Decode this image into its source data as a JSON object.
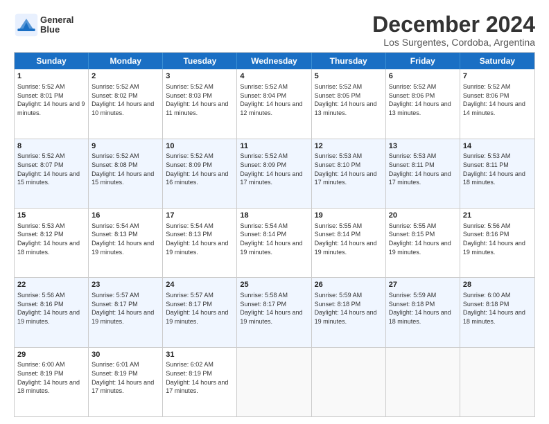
{
  "logo": {
    "line1": "General",
    "line2": "Blue"
  },
  "title": "December 2024",
  "location": "Los Surgentes, Cordoba, Argentina",
  "days_of_week": [
    "Sunday",
    "Monday",
    "Tuesday",
    "Wednesday",
    "Thursday",
    "Friday",
    "Saturday"
  ],
  "weeks": [
    [
      {
        "day": "1",
        "sunrise": "5:52 AM",
        "sunset": "8:01 PM",
        "daylight": "14 hours and 9 minutes."
      },
      {
        "day": "2",
        "sunrise": "5:52 AM",
        "sunset": "8:02 PM",
        "daylight": "14 hours and 10 minutes."
      },
      {
        "day": "3",
        "sunrise": "5:52 AM",
        "sunset": "8:03 PM",
        "daylight": "14 hours and 11 minutes."
      },
      {
        "day": "4",
        "sunrise": "5:52 AM",
        "sunset": "8:04 PM",
        "daylight": "14 hours and 12 minutes."
      },
      {
        "day": "5",
        "sunrise": "5:52 AM",
        "sunset": "8:05 PM",
        "daylight": "14 hours and 13 minutes."
      },
      {
        "day": "6",
        "sunrise": "5:52 AM",
        "sunset": "8:06 PM",
        "daylight": "14 hours and 13 minutes."
      },
      {
        "day": "7",
        "sunrise": "5:52 AM",
        "sunset": "8:06 PM",
        "daylight": "14 hours and 14 minutes."
      }
    ],
    [
      {
        "day": "8",
        "sunrise": "5:52 AM",
        "sunset": "8:07 PM",
        "daylight": "14 hours and 15 minutes."
      },
      {
        "day": "9",
        "sunrise": "5:52 AM",
        "sunset": "8:08 PM",
        "daylight": "14 hours and 15 minutes."
      },
      {
        "day": "10",
        "sunrise": "5:52 AM",
        "sunset": "8:09 PM",
        "daylight": "14 hours and 16 minutes."
      },
      {
        "day": "11",
        "sunrise": "5:52 AM",
        "sunset": "8:09 PM",
        "daylight": "14 hours and 17 minutes."
      },
      {
        "day": "12",
        "sunrise": "5:53 AM",
        "sunset": "8:10 PM",
        "daylight": "14 hours and 17 minutes."
      },
      {
        "day": "13",
        "sunrise": "5:53 AM",
        "sunset": "8:11 PM",
        "daylight": "14 hours and 17 minutes."
      },
      {
        "day": "14",
        "sunrise": "5:53 AM",
        "sunset": "8:11 PM",
        "daylight": "14 hours and 18 minutes."
      }
    ],
    [
      {
        "day": "15",
        "sunrise": "5:53 AM",
        "sunset": "8:12 PM",
        "daylight": "14 hours and 18 minutes."
      },
      {
        "day": "16",
        "sunrise": "5:54 AM",
        "sunset": "8:13 PM",
        "daylight": "14 hours and 19 minutes."
      },
      {
        "day": "17",
        "sunrise": "5:54 AM",
        "sunset": "8:13 PM",
        "daylight": "14 hours and 19 minutes."
      },
      {
        "day": "18",
        "sunrise": "5:54 AM",
        "sunset": "8:14 PM",
        "daylight": "14 hours and 19 minutes."
      },
      {
        "day": "19",
        "sunrise": "5:55 AM",
        "sunset": "8:14 PM",
        "daylight": "14 hours and 19 minutes."
      },
      {
        "day": "20",
        "sunrise": "5:55 AM",
        "sunset": "8:15 PM",
        "daylight": "14 hours and 19 minutes."
      },
      {
        "day": "21",
        "sunrise": "5:56 AM",
        "sunset": "8:16 PM",
        "daylight": "14 hours and 19 minutes."
      }
    ],
    [
      {
        "day": "22",
        "sunrise": "5:56 AM",
        "sunset": "8:16 PM",
        "daylight": "14 hours and 19 minutes."
      },
      {
        "day": "23",
        "sunrise": "5:57 AM",
        "sunset": "8:17 PM",
        "daylight": "14 hours and 19 minutes."
      },
      {
        "day": "24",
        "sunrise": "5:57 AM",
        "sunset": "8:17 PM",
        "daylight": "14 hours and 19 minutes."
      },
      {
        "day": "25",
        "sunrise": "5:58 AM",
        "sunset": "8:17 PM",
        "daylight": "14 hours and 19 minutes."
      },
      {
        "day": "26",
        "sunrise": "5:59 AM",
        "sunset": "8:18 PM",
        "daylight": "14 hours and 19 minutes."
      },
      {
        "day": "27",
        "sunrise": "5:59 AM",
        "sunset": "8:18 PM",
        "daylight": "14 hours and 18 minutes."
      },
      {
        "day": "28",
        "sunrise": "6:00 AM",
        "sunset": "8:18 PM",
        "daylight": "14 hours and 18 minutes."
      }
    ],
    [
      {
        "day": "29",
        "sunrise": "6:00 AM",
        "sunset": "8:19 PM",
        "daylight": "14 hours and 18 minutes."
      },
      {
        "day": "30",
        "sunrise": "6:01 AM",
        "sunset": "8:19 PM",
        "daylight": "14 hours and 17 minutes."
      },
      {
        "day": "31",
        "sunrise": "6:02 AM",
        "sunset": "8:19 PM",
        "daylight": "14 hours and 17 minutes."
      },
      null,
      null,
      null,
      null
    ]
  ]
}
